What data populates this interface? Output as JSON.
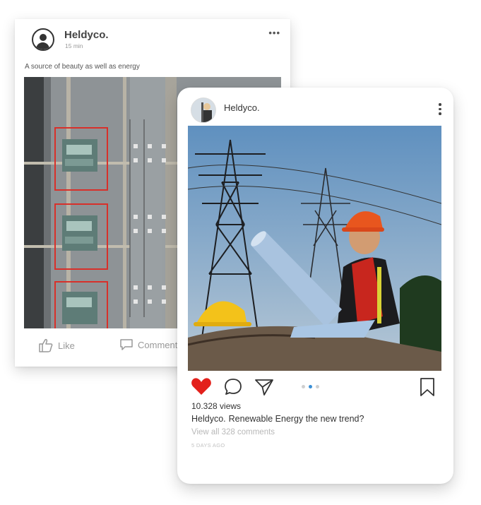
{
  "post1": {
    "author": "Heldyco.",
    "time": "15 min",
    "caption": "A source of beauty as well as energy",
    "image_icon": "substation-aerial-photo",
    "like_label": "Like",
    "comment_label": "Comment"
  },
  "post2": {
    "author": "Heldyco.",
    "image_icon": "engineer-power-tower-photo",
    "views": "10.328 views",
    "caption_author": "Heldyco.",
    "caption_text": "Renewable Energy the new trend?",
    "view_comments": "View all 328 comments",
    "time_ago": "5 DAYS AGO",
    "carousel": {
      "count": 3,
      "active": 2
    },
    "colors": {
      "heart": "#e3201b",
      "carousel_active": "#3a8fd6"
    }
  }
}
